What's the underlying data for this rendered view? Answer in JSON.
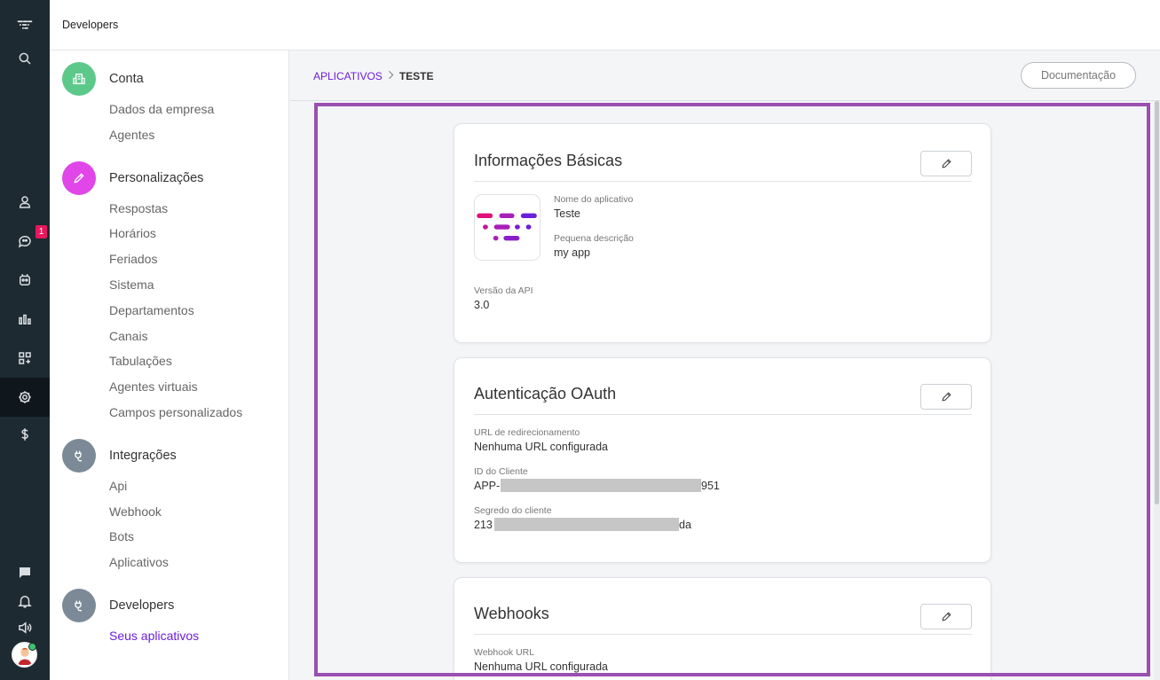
{
  "topbar": {
    "title": "Developers"
  },
  "rail": {
    "icons": [
      "logo-icon",
      "search-icon",
      "user-icon",
      "chat-icon",
      "bot-icon",
      "chart-icon",
      "apps-icon",
      "gear-icon",
      "dollar-icon",
      "message-icon",
      "bell-icon",
      "speaker-icon"
    ],
    "notification_count": "1"
  },
  "nav": {
    "sections": [
      {
        "title": "Conta",
        "color": "#5cc98a",
        "items": [
          "Dados da empresa",
          "Agentes"
        ]
      },
      {
        "title": "Personalizações",
        "color": "#e046e8",
        "items": [
          "Respostas",
          "Horários",
          "Feriados",
          "Sistema",
          "Departamentos",
          "Canais",
          "Tabulações",
          "Agentes virtuais",
          "Campos personalizados"
        ]
      },
      {
        "title": "Integrações",
        "color": "#7b8a96",
        "items": [
          "Api",
          "Webhook",
          "Bots",
          "Aplicativos"
        ]
      },
      {
        "title": "Developers",
        "color": "#7b8a96",
        "items": [
          "Seus aplicativos"
        ]
      }
    ]
  },
  "breadcrumb": {
    "parent": "APLICATIVOS",
    "current": "TESTE"
  },
  "doc_button": "Documentação",
  "cards": {
    "basic": {
      "title": "Informações Básicas",
      "name_label": "Nome do aplicativo",
      "name_value": "Teste",
      "desc_label": "Pequena descrição",
      "desc_value": "my app",
      "api_label": "Versão da API",
      "api_value": "3.0"
    },
    "oauth": {
      "title": "Autenticação OAuth",
      "redirect_label": "URL de redirecionamento",
      "redirect_value": "Nenhuma URL configurada",
      "client_id_label": "ID do Cliente",
      "client_id_prefix": "APP-",
      "client_id_suffix": "951",
      "secret_label": "Segredo do cliente",
      "secret_prefix": "213",
      "secret_suffix": "da"
    },
    "webhooks": {
      "title": "Webhooks",
      "url_label": "Webhook URL",
      "url_value": "Nenhuma URL configurada"
    }
  },
  "colors": {
    "accent": "#6a1fd9",
    "frame": "#9b4fb0",
    "rail": "#1e2a32",
    "badge": "#e8175d"
  }
}
